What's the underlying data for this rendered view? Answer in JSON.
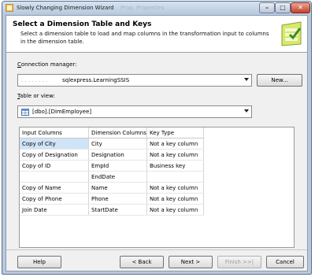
{
  "window": {
    "title": "Slowly Changing Dimension Wizard",
    "background_text": "Prop. Properties"
  },
  "header": {
    "title": "Select a Dimension Table and Keys",
    "description": "Select a dimension table to load and map columns in the transformation input to columns in the dimension table."
  },
  "connection": {
    "label_prefix": "C",
    "label_rest": "onnection manager:",
    "value": "sqlexpress.LearningSSIS",
    "new_button": "New..."
  },
  "table": {
    "label_prefix": "T",
    "label_rest": "able or view:",
    "value": "[dbo].[DimEmployee]"
  },
  "grid": {
    "headers": [
      "Input Columns",
      "Dimension Columns",
      "Key Type"
    ],
    "rows": [
      [
        "Copy of City",
        "City",
        "Not a key column"
      ],
      [
        "Copy of Designation",
        "Designation",
        "Not a key column"
      ],
      [
        "Copy of ID",
        "EmpId",
        "Business key"
      ],
      [
        "",
        "EndDate",
        ""
      ],
      [
        "Copy of Name",
        "Name",
        "Not a key column"
      ],
      [
        "Copy of Phone",
        "Phone",
        "Not a key column"
      ],
      [
        "Join Date",
        "StartDate",
        "Not a key column"
      ]
    ]
  },
  "footer": {
    "help": "Help",
    "back": "< Back",
    "next": "Next >",
    "finish": "Finish >>|",
    "cancel": "Cancel"
  },
  "colors": {
    "title_bar": "#b9c8dc",
    "close_button": "#c5412a",
    "selected_cell": "#cfe4f7"
  }
}
